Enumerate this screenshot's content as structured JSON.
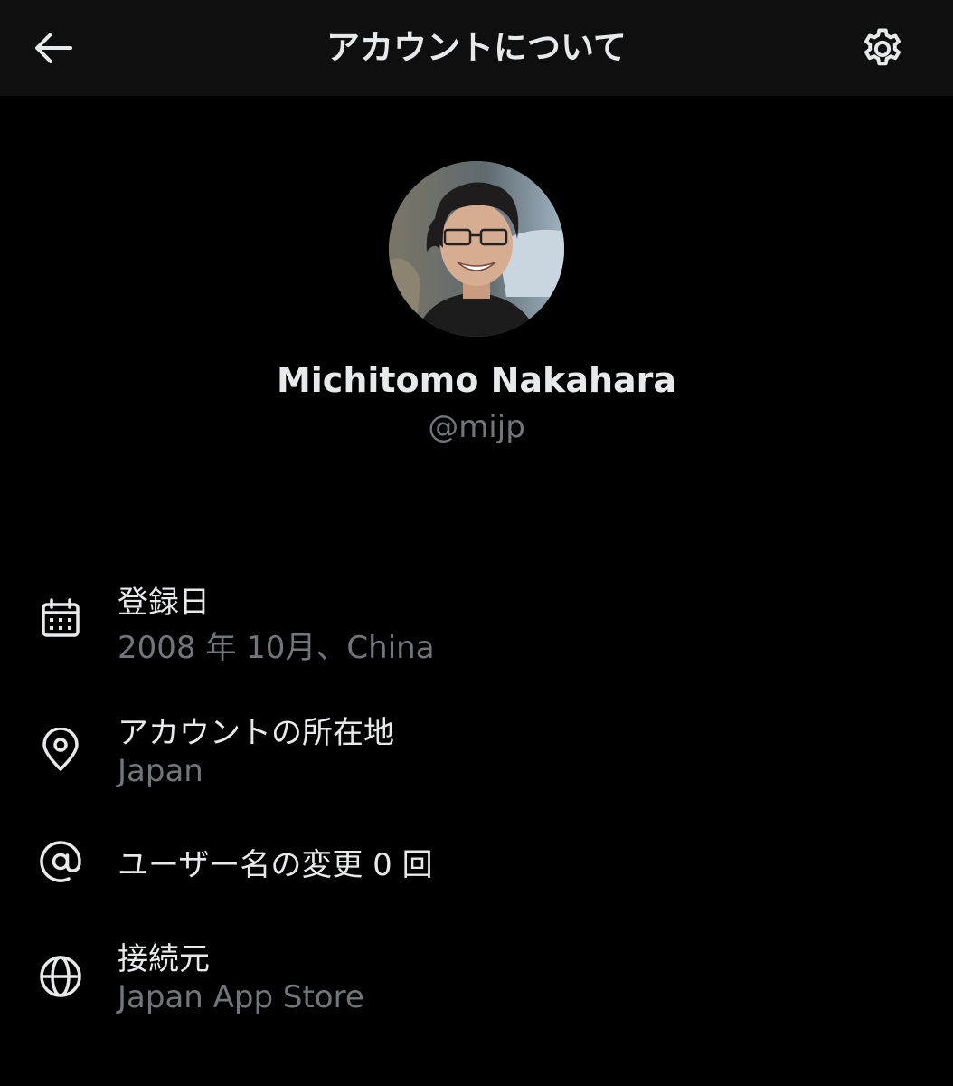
{
  "header": {
    "title": "アカウントについて",
    "back_icon": "arrow-left-icon",
    "settings_icon": "gear-icon"
  },
  "profile": {
    "name": "Michitomo Nakahara",
    "handle": "@mijp"
  },
  "info": {
    "joined": {
      "icon": "calendar-icon",
      "label": "登録日",
      "value": "2008 年 10月、China"
    },
    "location": {
      "icon": "location-pin-icon",
      "label": "アカウントの所在地",
      "value": "Japan"
    },
    "username_changes": {
      "icon": "at-sign-icon",
      "label": "ユーザー名の変更 0 回"
    },
    "connected_via": {
      "icon": "globe-icon",
      "label": "接続元",
      "value": "Japan App Store"
    }
  },
  "colors": {
    "background": "#000000",
    "topbar": "#0f0f0f",
    "primary_text": "#e7e9ea",
    "secondary_text": "#71767b"
  }
}
